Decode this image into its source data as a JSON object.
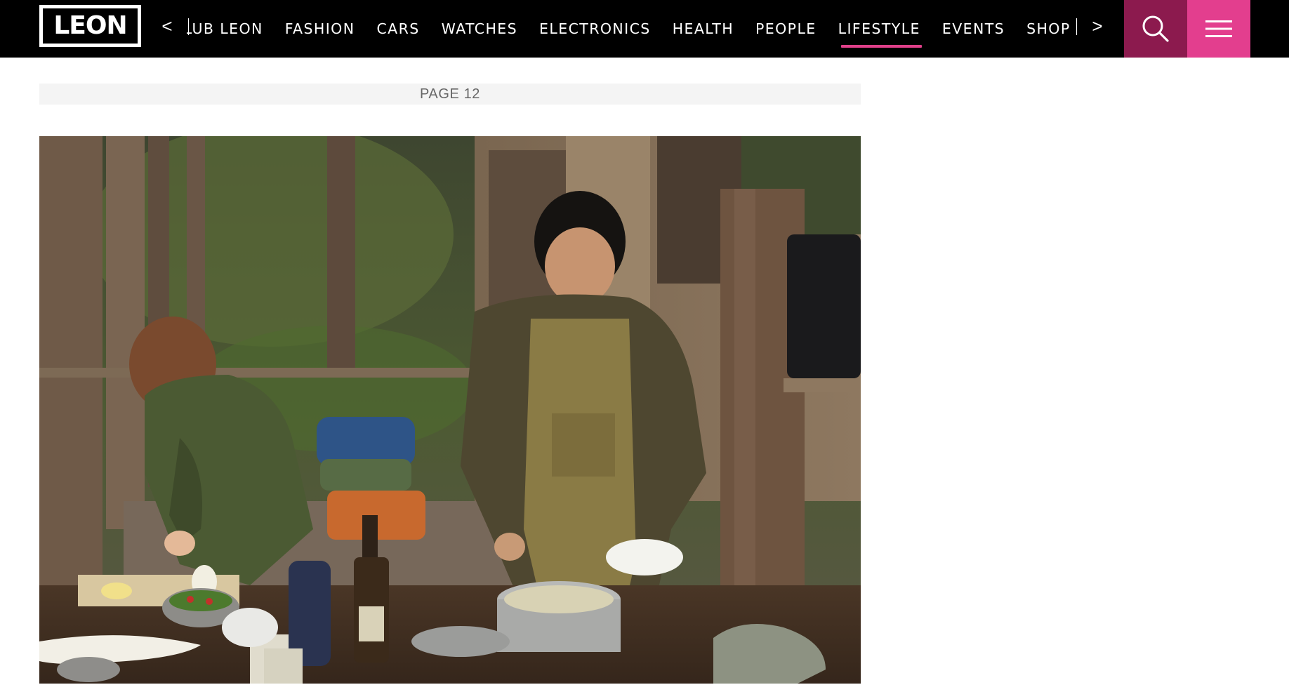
{
  "header": {
    "logo_text": "LEON",
    "prev_arrow": "<",
    "next_arrow": ">",
    "nav_items": [
      {
        "label": "CLUB LEON",
        "active": false
      },
      {
        "label": "FASHION",
        "active": false
      },
      {
        "label": "CARS",
        "active": false
      },
      {
        "label": "WATCHES",
        "active": false
      },
      {
        "label": "ELECTRONICS",
        "active": false
      },
      {
        "label": "HEALTH",
        "active": false
      },
      {
        "label": "PEOPLE",
        "active": false
      },
      {
        "label": "LIFESTYLE",
        "active": true
      },
      {
        "label": "EVENTS",
        "active": false
      },
      {
        "label": "SHOP",
        "active": false
      }
    ],
    "search_icon": "search-icon",
    "menu_icon": "hamburger-menu-icon",
    "colors": {
      "bar": "#000000",
      "search_bg": "#8c1a4e",
      "menu_bg": "#e33e8e",
      "active_underline": "#e0408a"
    }
  },
  "article": {
    "page_label": "PAGE 12"
  }
}
